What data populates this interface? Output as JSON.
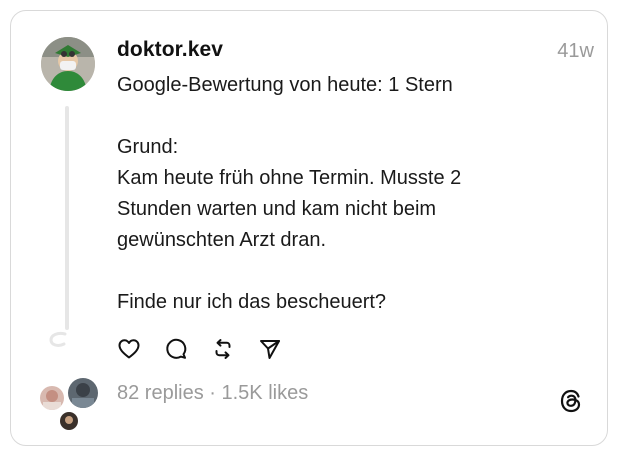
{
  "post": {
    "username": "doktor.kev",
    "timestamp": "41w",
    "lines": [
      "Google-Bewertung von heute: 1 Stern",
      "",
      "Grund:",
      "Kam heute früh ohne Termin. Musste 2",
      "Stunden warten und kam nicht beim",
      "gewünschten Arzt dran.",
      "",
      "Finde nur ich das bescheuert?"
    ]
  },
  "stats": {
    "replies": "82 replies",
    "separator": " · ",
    "likes": "1.5K likes"
  },
  "icons": {
    "like": "heart-icon",
    "reply": "comment-icon",
    "repost": "repost-icon",
    "share": "send-icon",
    "brand": "threads-logo-icon"
  },
  "colors": {
    "text": "#111111",
    "muted": "#9a9a9a",
    "border": "#d9d9d9",
    "thread_line": "#e6e6e6"
  }
}
